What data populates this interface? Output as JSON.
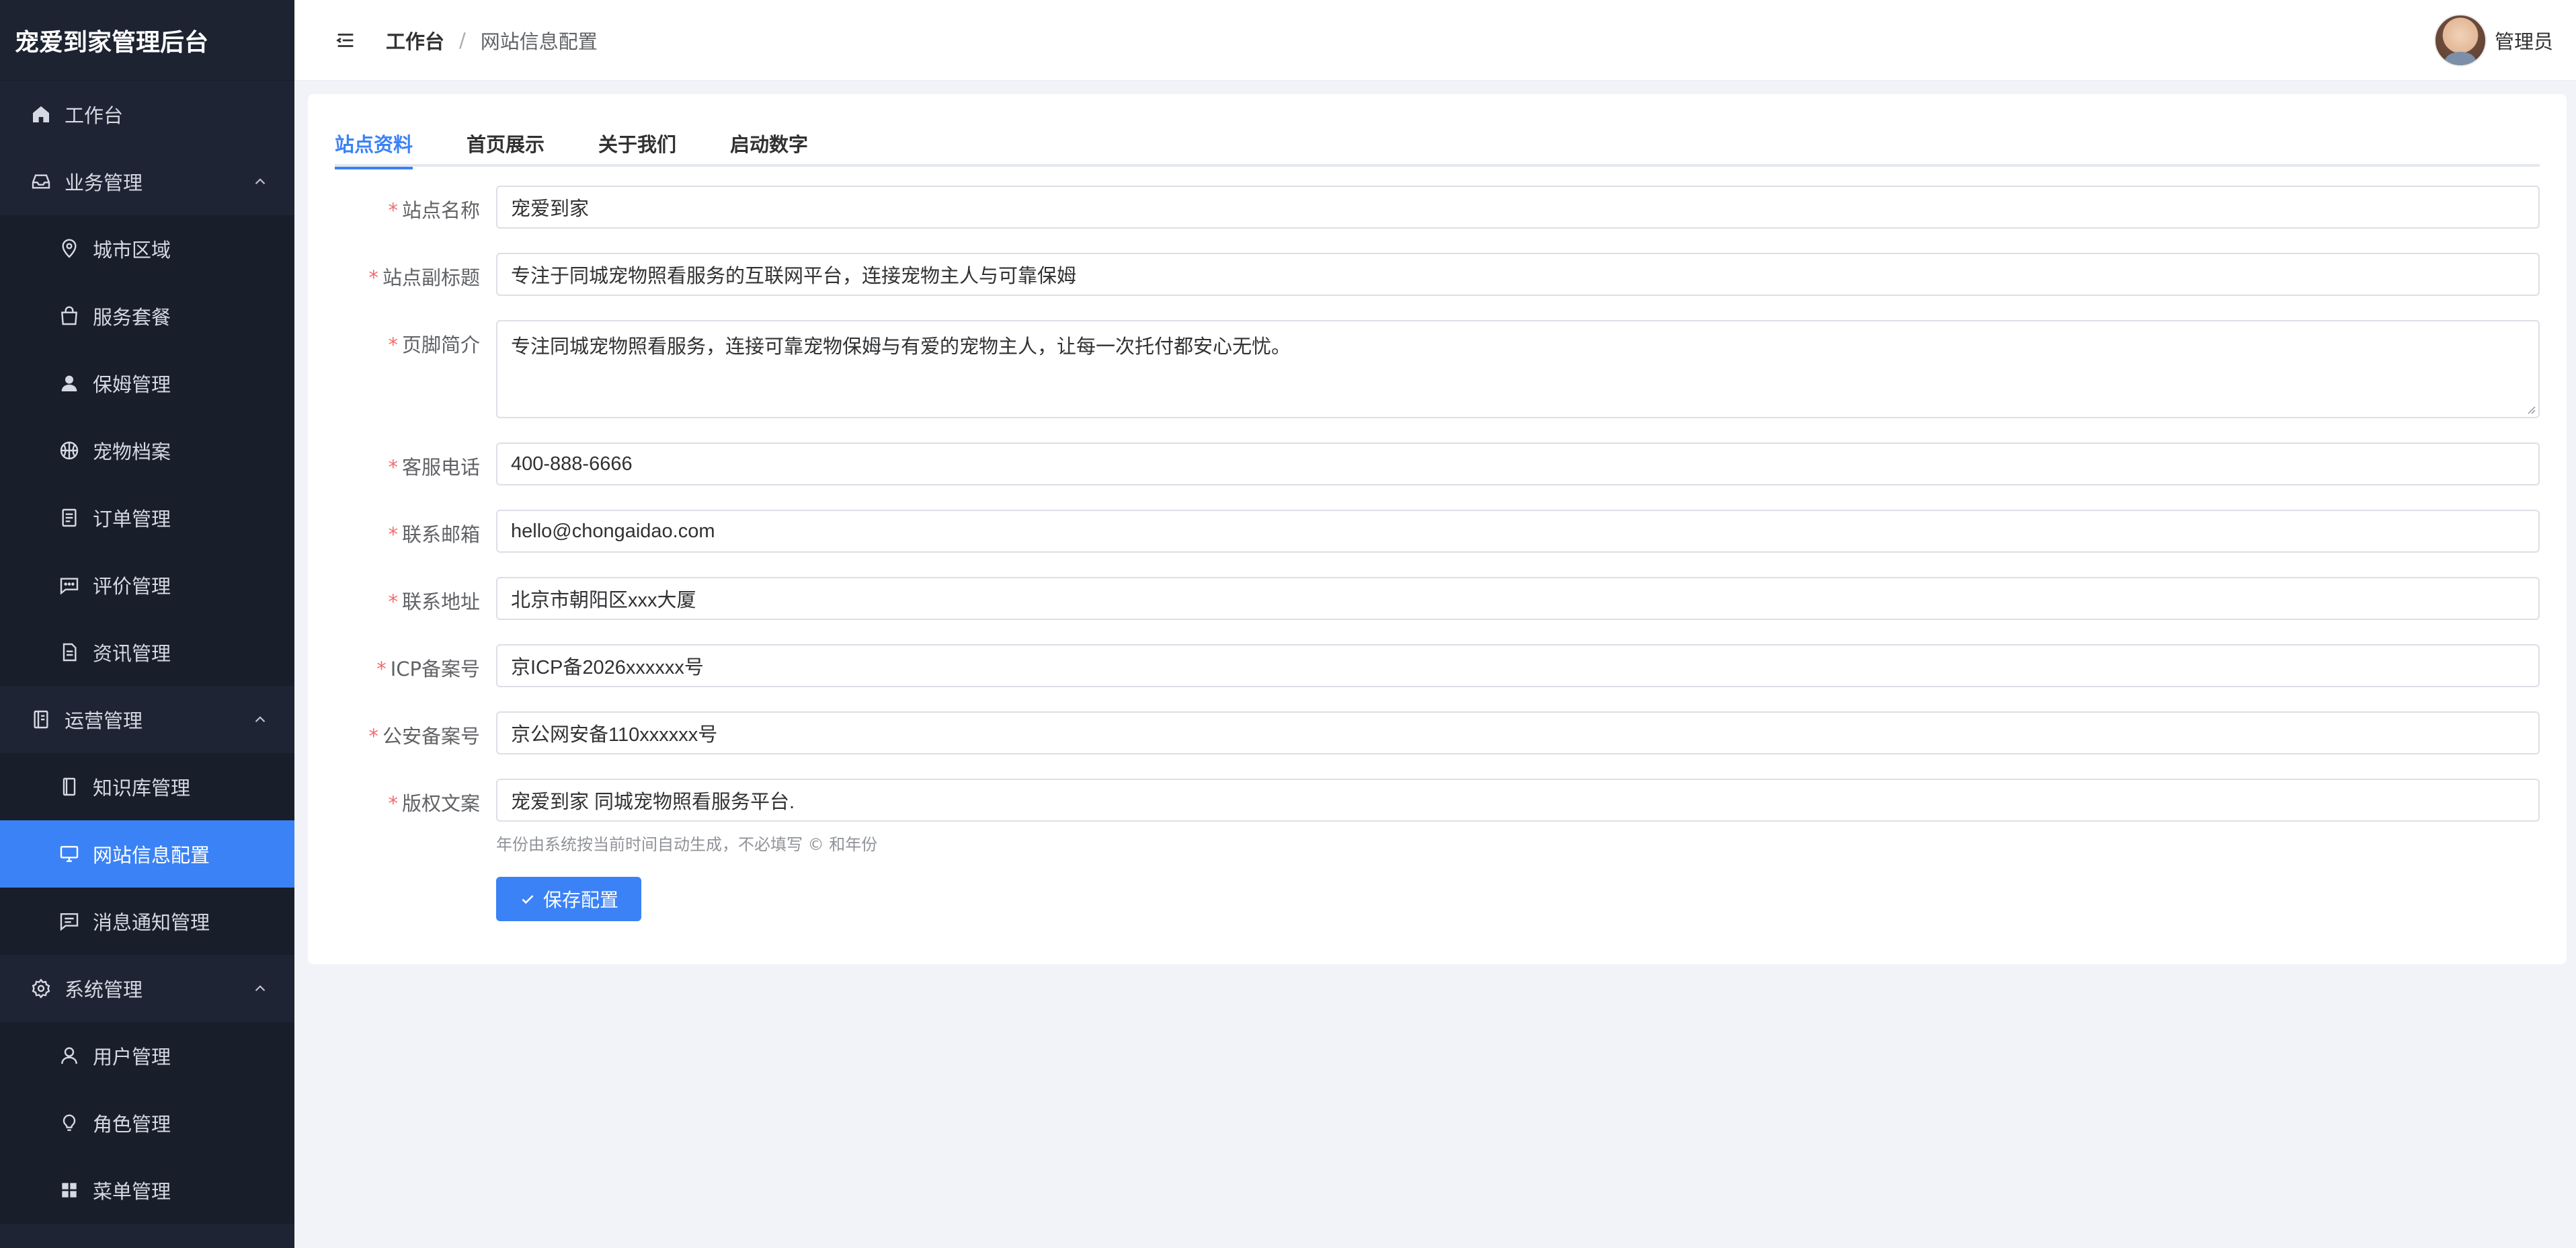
{
  "app": {
    "title": "宠爱到家管理后台"
  },
  "sidebar": {
    "items": [
      {
        "label": "工作台",
        "icon": "home-icon",
        "level": "top"
      },
      {
        "label": "业务管理",
        "icon": "inbox-icon",
        "level": "top",
        "expanded": true
      },
      {
        "label": "城市区域",
        "icon": "location-pin-icon",
        "level": "sub"
      },
      {
        "label": "服务套餐",
        "icon": "shopping-bag-icon",
        "level": "sub"
      },
      {
        "label": "保姆管理",
        "icon": "user-filled-icon",
        "level": "sub"
      },
      {
        "label": "宠物档案",
        "icon": "basketball-icon",
        "level": "sub"
      },
      {
        "label": "订单管理",
        "icon": "document-list-icon",
        "level": "sub"
      },
      {
        "label": "评价管理",
        "icon": "chat-dots-icon",
        "level": "sub"
      },
      {
        "label": "资讯管理",
        "icon": "document-icon",
        "level": "sub"
      },
      {
        "label": "运营管理",
        "icon": "notebook-icon",
        "level": "top",
        "expanded": true
      },
      {
        "label": "知识库管理",
        "icon": "book-icon",
        "level": "sub"
      },
      {
        "label": "网站信息配置",
        "icon": "monitor-icon",
        "level": "sub",
        "active": true
      },
      {
        "label": "消息通知管理",
        "icon": "chat-square-icon",
        "level": "sub"
      },
      {
        "label": "系统管理",
        "icon": "gear-icon",
        "level": "top",
        "expanded": true
      },
      {
        "label": "用户管理",
        "icon": "user-icon",
        "level": "sub"
      },
      {
        "label": "角色管理",
        "icon": "bulb-icon",
        "level": "sub"
      },
      {
        "label": "菜单管理",
        "icon": "grid-icon",
        "level": "sub"
      }
    ]
  },
  "header": {
    "breadcrumb": [
      "工作台",
      "网站信息配置"
    ],
    "separator": "/",
    "user_name": "管理员"
  },
  "tabs": [
    {
      "label": "站点资料",
      "active": true
    },
    {
      "label": "首页展示"
    },
    {
      "label": "关于我们"
    },
    {
      "label": "启动数字"
    }
  ],
  "form": {
    "required_mark": "*",
    "fields": [
      {
        "label": "站点名称",
        "value": "宠爱到家"
      },
      {
        "label": "站点副标题",
        "value": "专注于同城宠物照看服务的互联网平台，连接宠物主人与可靠保姆"
      },
      {
        "label": "页脚简介",
        "value": "专注同城宠物照看服务，连接可靠宠物保姆与有爱的宠物主人，让每一次托付都安心无忧。"
      },
      {
        "label": "客服电话",
        "value": "400-888-6666"
      },
      {
        "label": "联系邮箱",
        "value": "hello@chongaidao.com"
      },
      {
        "label": "联系地址",
        "value": "北京市朝阳区xxx大厦"
      },
      {
        "label": "ICP备案号",
        "value": "京ICP备2026xxxxxx号"
      },
      {
        "label": "公安备案号",
        "value": "京公网安备110xxxxxx号"
      },
      {
        "label": "版权文案",
        "value": "宠爱到家 同城宠物照看服务平台."
      }
    ],
    "hint": "年份由系统按当前时间自动生成，不必填写 © 和年份",
    "save_label": "保存配置"
  },
  "colors": {
    "sidebar_bg": "#1e2433",
    "accent": "#3b82f6",
    "required": "#f56c6c",
    "page_bg": "#f2f3f8"
  }
}
